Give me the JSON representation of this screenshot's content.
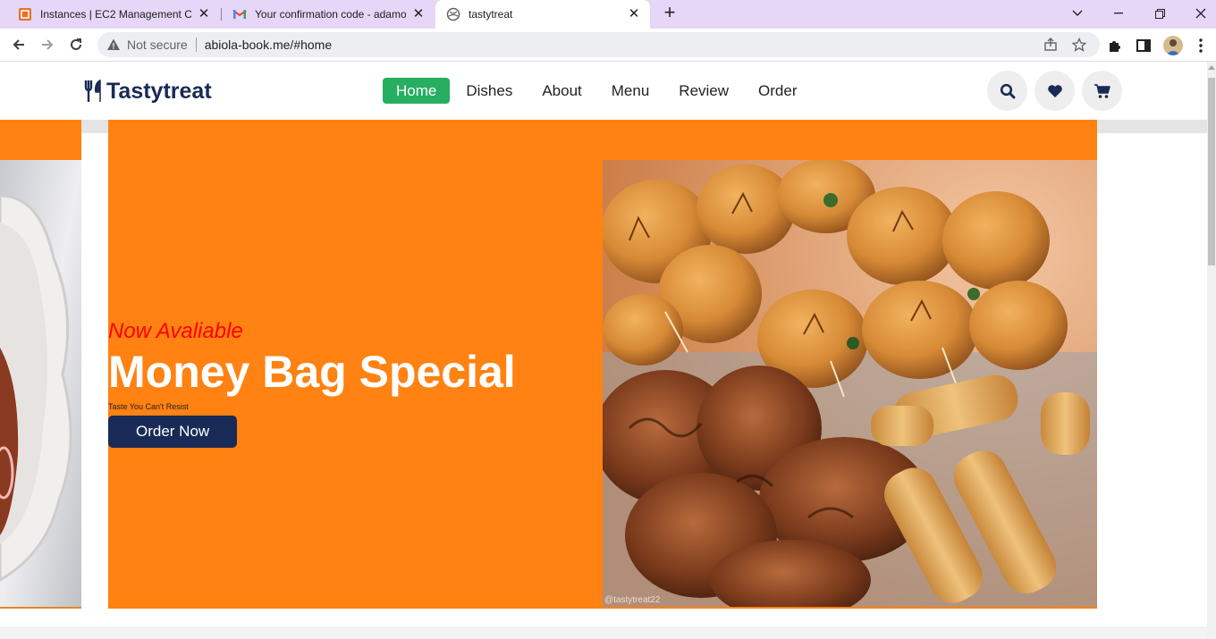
{
  "browser": {
    "tabs": [
      {
        "title": "Instances | EC2 Management Cor",
        "favicon": "aws-icon",
        "active": false
      },
      {
        "title": "Your confirmation code - adamo",
        "favicon": "gmail-icon",
        "active": false
      },
      {
        "title": "tastytreat",
        "favicon": "globe-icon",
        "active": true
      }
    ],
    "security_label": "Not secure",
    "url": "abiola-book.me/#home"
  },
  "site": {
    "logo_text": "Tastytreat",
    "nav": [
      {
        "label": "Home",
        "active": true
      },
      {
        "label": "Dishes",
        "active": false
      },
      {
        "label": "About",
        "active": false
      },
      {
        "label": "Menu",
        "active": false
      },
      {
        "label": "Review",
        "active": false
      },
      {
        "label": "Order",
        "active": false
      }
    ],
    "header_icons": [
      "search-icon",
      "heart-icon",
      "cart-icon"
    ]
  },
  "hero": {
    "subtitle": "Now Avaliable",
    "title": "Money Bag Special",
    "tagline": "Taste You Can't Resist",
    "button_label": "Order Now",
    "image_watermark": "@tastytreat22"
  },
  "colors": {
    "accent_orange": "#ff8212",
    "nav_active_green": "#27ae60",
    "brand_navy": "#192a56",
    "subtitle_red": "#ff0000"
  }
}
